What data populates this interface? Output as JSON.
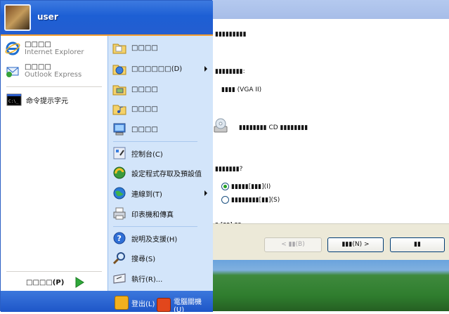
{
  "user": {
    "name": "user"
  },
  "pinned": [
    {
      "label": "□□□□",
      "sublabel": "Internet Explorer"
    },
    {
      "label": "□□□□",
      "sublabel": "Outlook Express"
    }
  ],
  "recent": [
    {
      "label": "命令提示字元"
    }
  ],
  "all_programs": {
    "label": "□□□□(P)"
  },
  "right_items": [
    {
      "label": "□□□□"
    },
    {
      "label": "□□□□□□(D)"
    },
    {
      "label": "□□□□"
    },
    {
      "label": "□□□□"
    },
    {
      "label": "□□□□"
    },
    {
      "label": "控制台(C)"
    },
    {
      "label": "設定程式存取及預設值"
    },
    {
      "label": "連線到(T)"
    },
    {
      "label": "印表機和傳真"
    },
    {
      "label": "說明及支援(H)"
    },
    {
      "label": "搜尋(S)"
    },
    {
      "label": "執行(R)..."
    }
  ],
  "footer": {
    "logoff": "登出(L)",
    "shutdown": "電腦關機(U)"
  },
  "wizard": {
    "line1": "▮▮▮▮▮▮▮▮▮",
    "line2": "▮▮▮▮▮▮▮▮:",
    "line3": "▮▮▮▮ (VGA II)",
    "cd_label": "▮▮▮▮▮▮▮▮ CD ▮▮▮▮▮▮▮▮",
    "question": "▮▮▮▮▮▮▮?",
    "option1": "▮▮▮▮▮[▮▮▮](I)",
    "option2": "▮▮▮▮▮▮▮▮[▮▮](S)",
    "partial": "▮ [▮▮] ▮▮",
    "back_button": "< ▮▮(B)",
    "next_button": "▮▮▮(N) >",
    "cancel_button": "▮▮"
  }
}
